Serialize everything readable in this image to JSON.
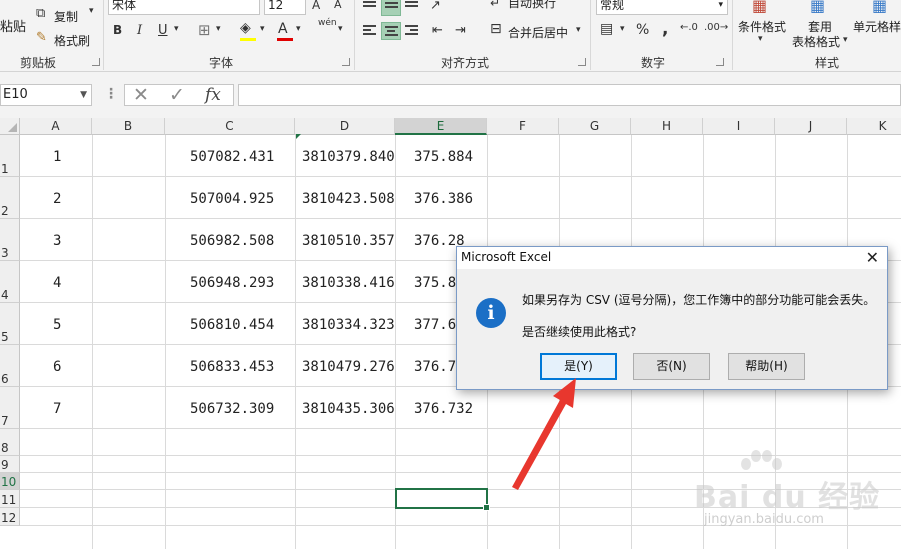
{
  "ribbon": {
    "clipboard": {
      "paste_label": "粘贴",
      "copy_label": "复制",
      "format_painter_label": "格式刷",
      "group_label": "剪贴板"
    },
    "font": {
      "font_name": "宋体",
      "font_size": "12",
      "bold": "B",
      "italic": "I",
      "underline": "U",
      "font_color_glyph": "A",
      "phonetic_glyph": "wén",
      "group_label": "字体"
    },
    "alignment": {
      "wrap_text_label": "自动换行",
      "merge_center_label": "合并后居中",
      "group_label": "对齐方式"
    },
    "number": {
      "format_value": "常规",
      "percent": "%",
      "comma": ",",
      "group_label": "数字"
    },
    "styles": {
      "conditional_format_label": "条件格式",
      "table_format_line1": "套用",
      "table_format_line2": "表格格式",
      "cell_styles_label": "单元格样",
      "group_label": "样式"
    }
  },
  "formula_bar": {
    "name_box": "E10",
    "fx": "fx"
  },
  "sheet": {
    "columns": [
      "A",
      "B",
      "C",
      "D",
      "E",
      "F",
      "G",
      "H",
      "I",
      "J",
      "K"
    ],
    "rows": [
      "1",
      "2",
      "3",
      "4",
      "5",
      "6",
      "7",
      "8",
      "9",
      "10",
      "11",
      "12"
    ],
    "colA": [
      "1",
      "2",
      "3",
      "4",
      "5",
      "6",
      "7"
    ],
    "colC": [
      "507082.431",
      "507004.925",
      "506982.508",
      "506948.293",
      "506810.454",
      "506833.453",
      "506732.309"
    ],
    "colD": [
      "3810379.840",
      "3810423.508",
      "3810510.357",
      "3810338.416",
      "3810334.323",
      "3810479.276",
      "3810435.306"
    ],
    "colE": [
      "375.884",
      "376.386",
      "376.28",
      "375.8",
      "377.6",
      "376.7",
      "376.732"
    ]
  },
  "dialog": {
    "title": "Microsoft Excel",
    "close_glyph": "✕",
    "icon_glyph": "i",
    "message_line1": "如果另存为 CSV (逗号分隔)，您工作簿中的部分功能可能会丢失。",
    "message_line2": "是否继续使用此格式?",
    "buttons": {
      "yes": "是(Y)",
      "no": "否(N)",
      "help": "帮助(H)"
    }
  },
  "watermark": {
    "logo_text": "Bai du 经验",
    "url": "jingyan.baidu.com"
  },
  "colors": {
    "accent_green": "#217346",
    "dialog_default_border": "#0078d7",
    "info_icon_blue": "#1b6fc6",
    "arrow_red": "#e8372e"
  }
}
